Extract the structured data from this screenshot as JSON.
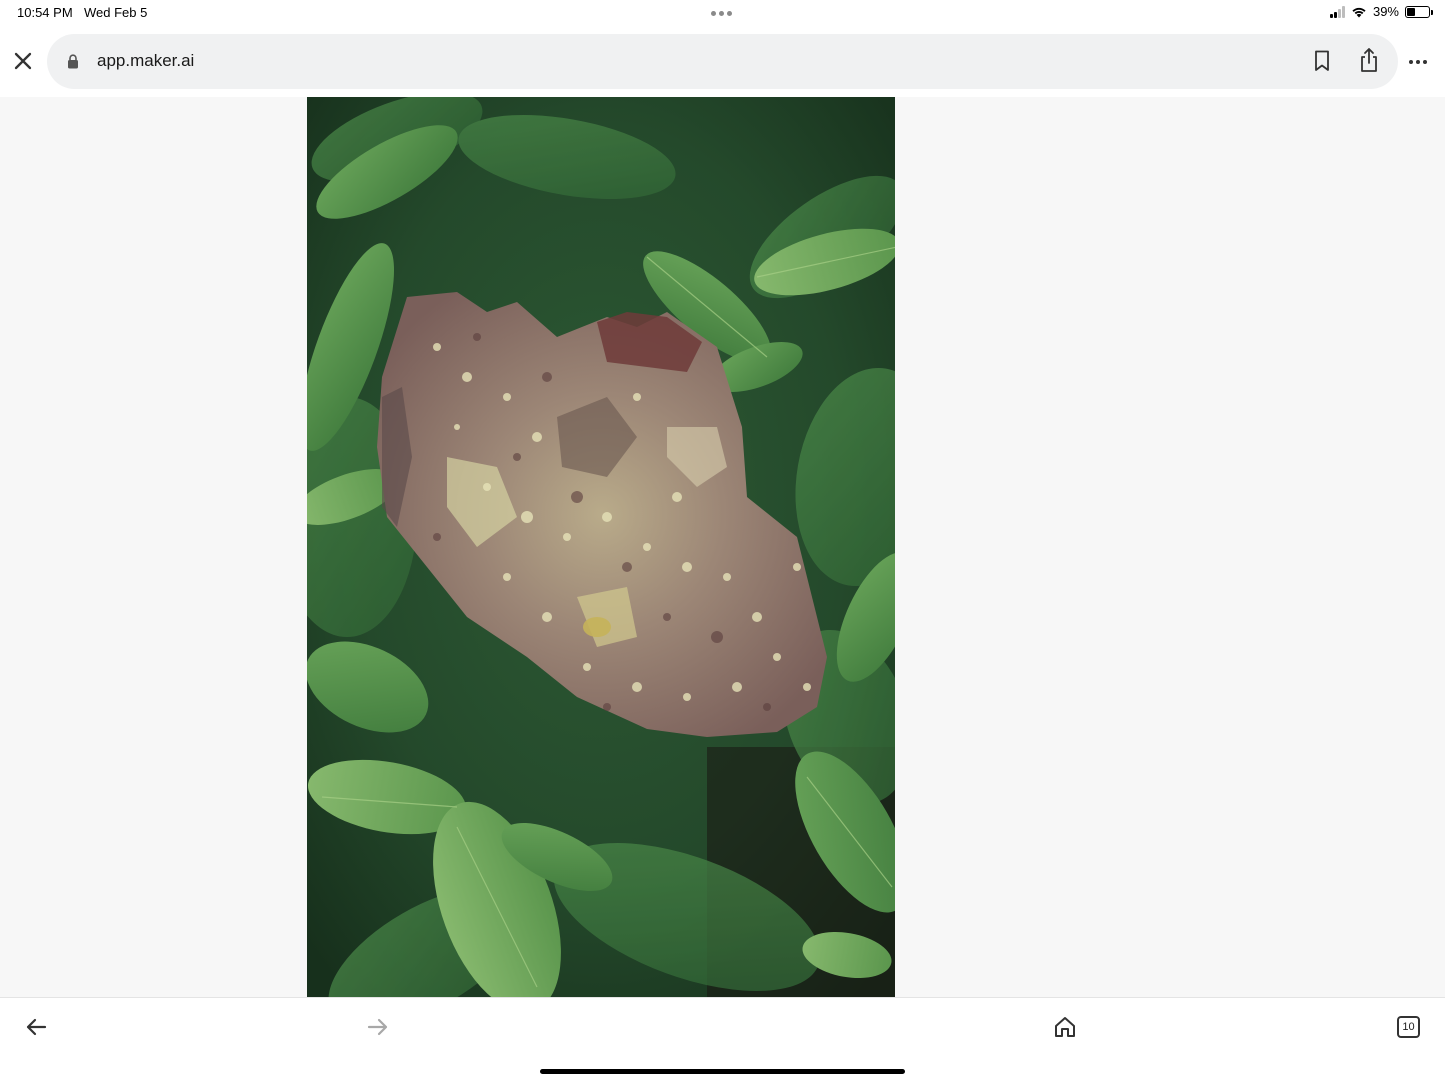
{
  "status_bar": {
    "time": "10:54 PM",
    "date": "Wed Feb 5",
    "battery_percent": "39%",
    "battery_level": 0.39,
    "signal_bars_active": 2,
    "icons": [
      "signal-icon",
      "wifi-icon",
      "battery-icon"
    ]
  },
  "browser": {
    "url": "app.maker.ai",
    "icons": [
      "close-icon",
      "lock-icon",
      "bookmark-icon",
      "share-icon",
      "more-icon"
    ]
  },
  "content": {
    "image_subject": "mineral specimen on green leaves"
  },
  "bottom_bar": {
    "tab_count": "10",
    "icons": [
      "back-arrow-icon",
      "forward-arrow-icon",
      "home-icon",
      "tabs-icon"
    ]
  },
  "colors": {
    "url_bar_bg": "#f0f1f2",
    "content_bg": "#f7f7f7",
    "leaf_green": "#4f8f46"
  }
}
